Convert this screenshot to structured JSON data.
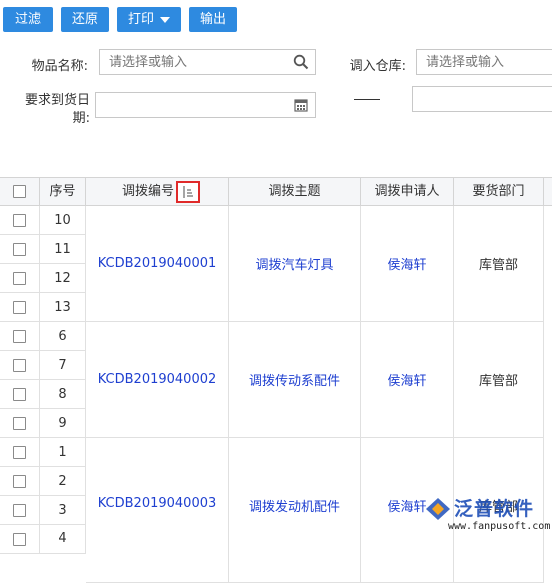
{
  "toolbar": {
    "filter_label": "过滤",
    "restore_label": "还原",
    "print_label": "打印",
    "export_label": "输出"
  },
  "filters": {
    "item_name_label": "物品名称:",
    "item_name_placeholder": "请选择或输入",
    "in_warehouse_label": "调入仓库:",
    "in_warehouse_placeholder": "请选择或输入",
    "required_date_label_line1": "要求到货日",
    "required_date_label_line2": "期:"
  },
  "table": {
    "columns": {
      "seq": "序号",
      "transfer_no": "调拨编号",
      "subject": "调拨主题",
      "applicant": "调拨申请人",
      "dept": "要货部门"
    },
    "groups": [
      {
        "transfer_no": "KCDB2019040001",
        "subject": "调拨汽车灯具",
        "applicant": "侯海轩",
        "dept": "库管部",
        "rows": [
          "10",
          "11",
          "12",
          "13"
        ]
      },
      {
        "transfer_no": "KCDB2019040002",
        "subject": "调拨传动系配件",
        "applicant": "侯海轩",
        "dept": "库管部",
        "rows": [
          "6",
          "7",
          "8",
          "9"
        ]
      },
      {
        "transfer_no": "KCDB2019040003",
        "subject": "调拨发动机配件",
        "applicant": "侯海轩",
        "dept": "库管部",
        "rows": [
          "1",
          "2",
          "3",
          "4"
        ]
      }
    ]
  },
  "watermark": {
    "brand": "泛普软件",
    "url": "www.fanpusoft.com"
  },
  "colors": {
    "button": "#2e8ae0",
    "link": "#1e3fd0",
    "highlight": "#e02a2a"
  }
}
